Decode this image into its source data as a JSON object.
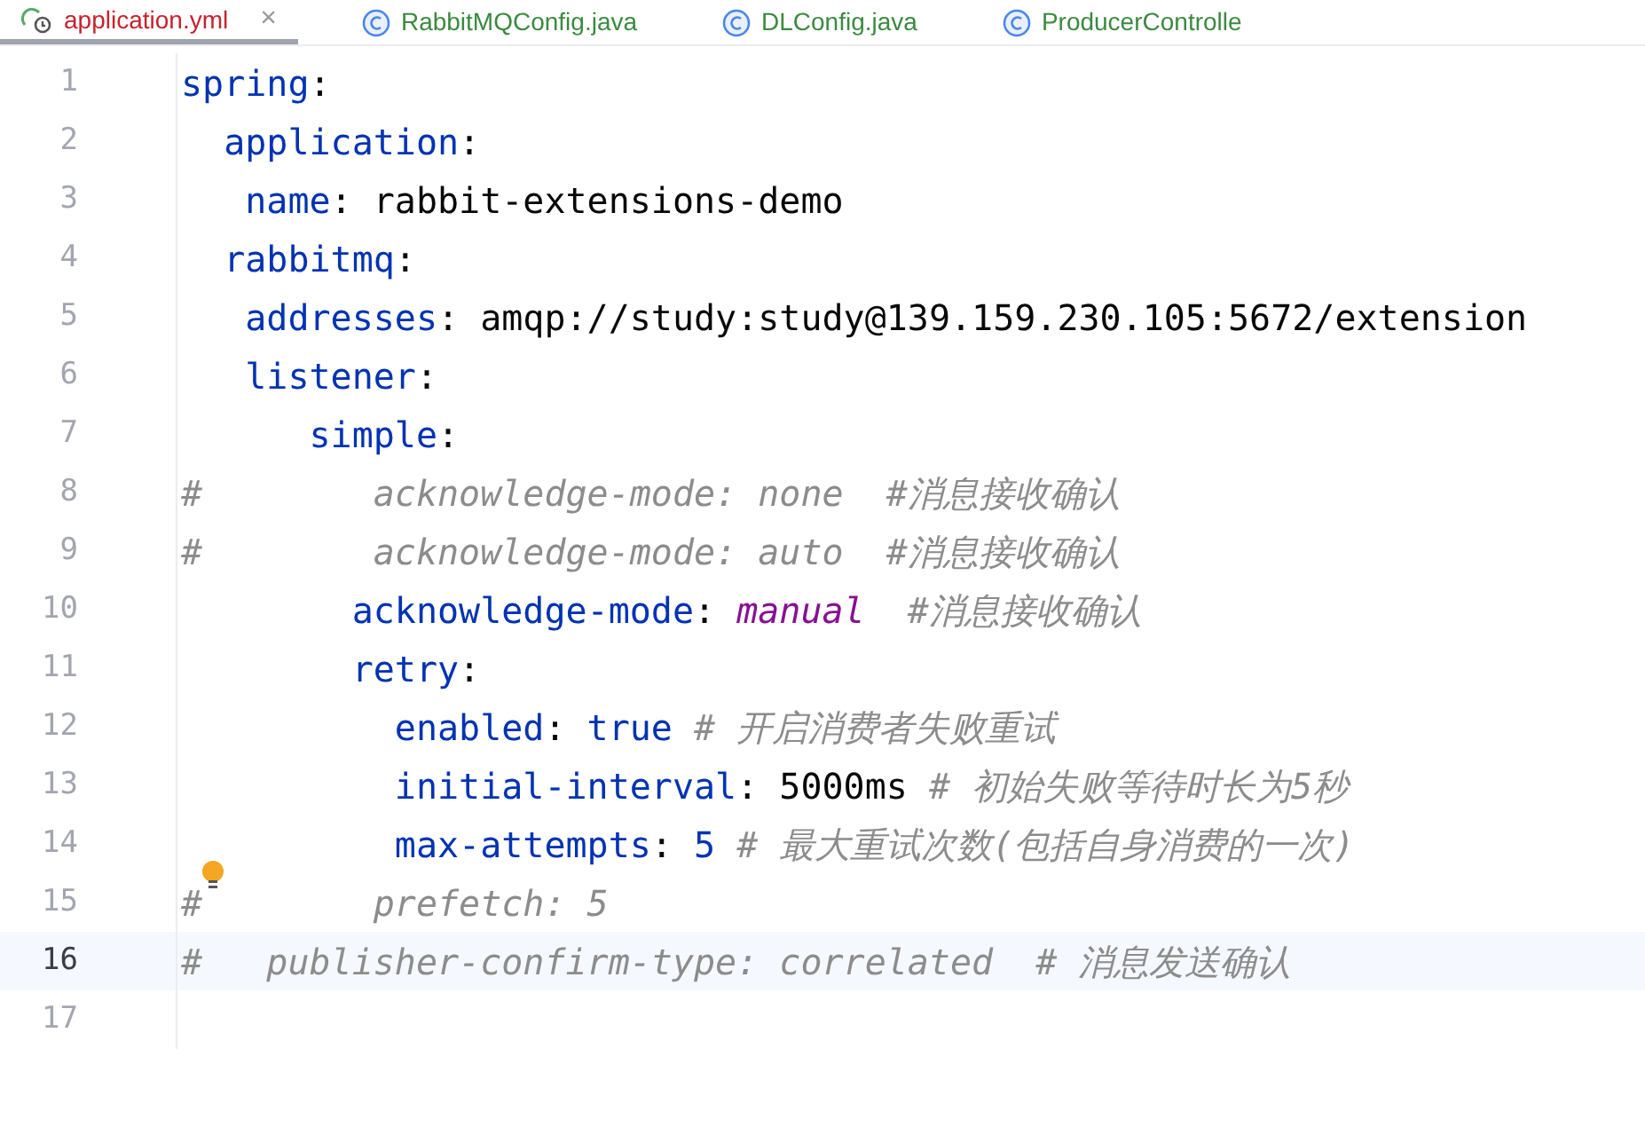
{
  "tabs": [
    {
      "label": "application.yml",
      "kind": "yaml",
      "selected": true,
      "closable": true
    },
    {
      "label": "RabbitMQConfig.java",
      "kind": "java",
      "selected": false,
      "closable": false
    },
    {
      "label": "DLConfig.java",
      "kind": "java",
      "selected": false,
      "closable": false
    },
    {
      "label": "ProducerControlle",
      "kind": "java",
      "selected": false,
      "closable": false
    }
  ],
  "close_glyph": "×",
  "lines": [
    {
      "number": "1",
      "current": false,
      "tokens": [
        {
          "kind": "key",
          "text": "spring"
        },
        {
          "kind": "punct",
          "text": ":"
        }
      ]
    },
    {
      "number": "2",
      "current": false,
      "tokens": [
        {
          "kind": "key",
          "text": "  application"
        },
        {
          "kind": "punct",
          "text": ":"
        }
      ]
    },
    {
      "number": "3",
      "current": false,
      "tokens": [
        {
          "kind": "key",
          "text": "   name"
        },
        {
          "kind": "punct",
          "text": ": rabbit-extensions-demo"
        }
      ]
    },
    {
      "number": "4",
      "current": false,
      "tokens": [
        {
          "kind": "key",
          "text": "  rabbitmq"
        },
        {
          "kind": "punct",
          "text": ":"
        }
      ]
    },
    {
      "number": "5",
      "current": false,
      "tokens": [
        {
          "kind": "key",
          "text": "   addresses"
        },
        {
          "kind": "punct",
          "text": ": amqp://study:study@139.159.230.105:5672/extension"
        }
      ]
    },
    {
      "number": "6",
      "current": false,
      "tokens": [
        {
          "kind": "key",
          "text": "   listener"
        },
        {
          "kind": "punct",
          "text": ":"
        }
      ]
    },
    {
      "number": "7",
      "current": false,
      "tokens": [
        {
          "kind": "key",
          "text": "      simple"
        },
        {
          "kind": "punct",
          "text": ":"
        }
      ]
    },
    {
      "number": "8",
      "current": false,
      "tokens": [
        {
          "kind": "comment",
          "text": "#        acknowledge-mode: none  #消息接收确认"
        }
      ]
    },
    {
      "number": "9",
      "current": false,
      "tokens": [
        {
          "kind": "comment",
          "text": "#        acknowledge-mode: auto  #消息接收确认"
        }
      ]
    },
    {
      "number": "10",
      "current": false,
      "tokens": [
        {
          "kind": "key",
          "text": "        acknowledge-mode"
        },
        {
          "kind": "punct",
          "text": ": "
        },
        {
          "kind": "enum",
          "text": "manual"
        },
        {
          "kind": "comment",
          "text": "  #消息接收确认"
        }
      ]
    },
    {
      "number": "11",
      "current": false,
      "tokens": [
        {
          "kind": "key",
          "text": "        retry"
        },
        {
          "kind": "punct",
          "text": ":"
        }
      ]
    },
    {
      "number": "12",
      "current": false,
      "tokens": [
        {
          "kind": "key",
          "text": "          enabled"
        },
        {
          "kind": "punct",
          "text": ": "
        },
        {
          "kind": "literal",
          "text": "true"
        },
        {
          "kind": "comment",
          "text": " # 开启消费者失败重试"
        }
      ]
    },
    {
      "number": "13",
      "current": false,
      "tokens": [
        {
          "kind": "key",
          "text": "          initial-interval"
        },
        {
          "kind": "punct",
          "text": ": 5000ms"
        },
        {
          "kind": "comment",
          "text": " # 初始失败等待时长为5秒"
        }
      ]
    },
    {
      "number": "14",
      "current": false,
      "tokens": [
        {
          "kind": "key",
          "text": "          max-attempts"
        },
        {
          "kind": "punct",
          "text": ": "
        },
        {
          "kind": "literal",
          "text": "5"
        },
        {
          "kind": "comment",
          "text": " # 最大重试次数(包括自身消费的一次)"
        }
      ]
    },
    {
      "number": "15",
      "current": false,
      "bulb": true,
      "tokens": [
        {
          "kind": "comment",
          "text": "#        prefetch: 5"
        }
      ]
    },
    {
      "number": "16",
      "current": true,
      "tokens": [
        {
          "kind": "comment",
          "text": "#   publisher-confirm-type: correlated  # 消息发送确认"
        }
      ]
    },
    {
      "number": "17",
      "current": false
    }
  ]
}
